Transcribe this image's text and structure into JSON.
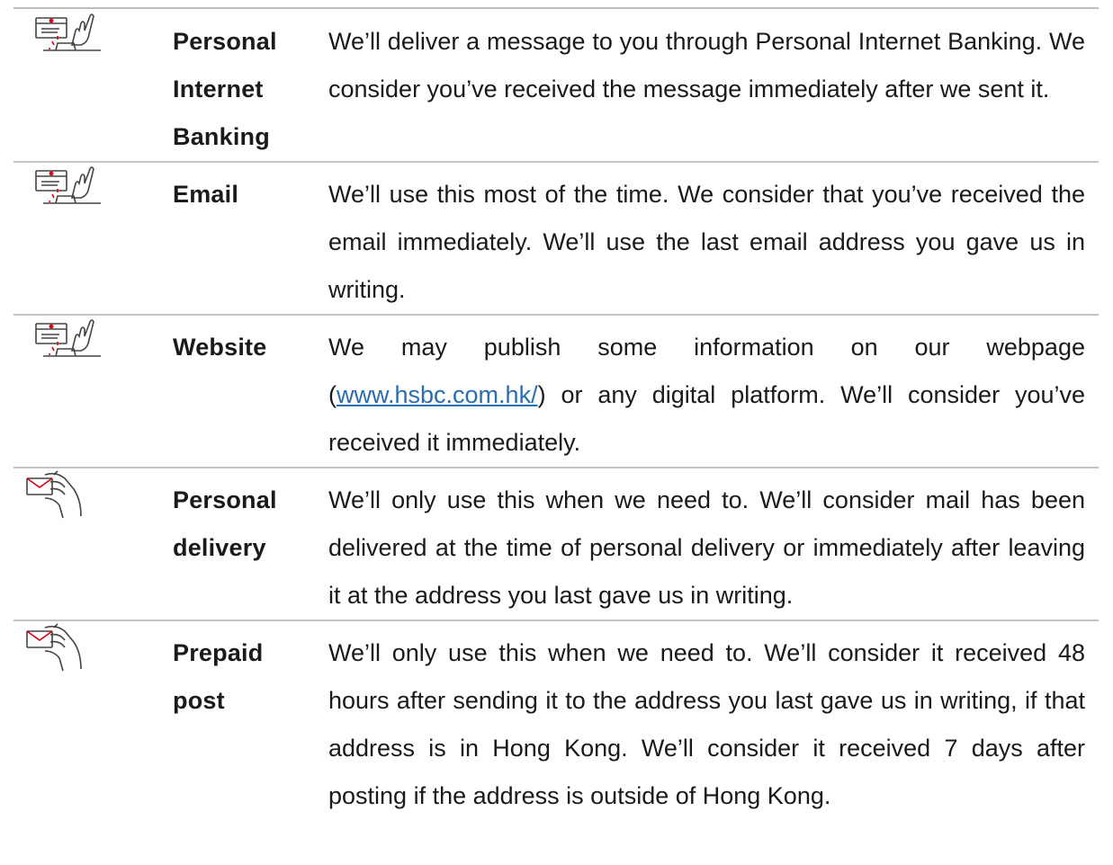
{
  "rows": [
    {
      "icon": "computer-hand-icon",
      "method": "Personal Internet Banking",
      "description": "We’ll deliver a message to you through Personal Internet Banking. We consider you’ve received the message immediately after we sent it."
    },
    {
      "icon": "computer-hand-icon",
      "method": "Email",
      "description": "We’ll use this most of the time. We consider that you’ve received the email immediately. We’ll use the last email address you gave us in writing."
    },
    {
      "icon": "computer-hand-icon",
      "method": "Website",
      "description_before": "We may publish some information on our webpage (",
      "link_text": "www.hsbc.com.hk/",
      "description_after": ") or any digital platform. We’ll consider you’ve received it immediately."
    },
    {
      "icon": "hand-envelope-icon",
      "method": "Personal delivery",
      "description": "We’ll only use this when we need to. We’ll consider mail has been delivered at the time of personal delivery or immediately after leaving it at the address you last gave us in writing."
    },
    {
      "icon": "hand-envelope-icon",
      "method": "Prepaid post",
      "description": "We’ll only use this when we need to. We’ll consider it received 48 hours after sending it to the address you last gave us in writing, if that address is in Hong Kong. We’ll consider it received 7 days after posting if the address is outside of Hong Kong."
    }
  ],
  "colors": {
    "text": "#1a1a1a",
    "link": "#2a6db0",
    "accent_red": "#db0011",
    "rule": "#c4c4c4"
  }
}
